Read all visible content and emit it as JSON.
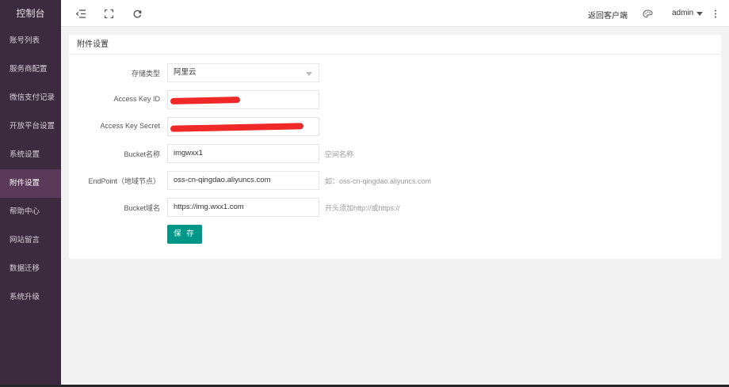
{
  "sidebar": {
    "brand": "控制台",
    "items": [
      {
        "label": "账号列表"
      },
      {
        "label": "服务商配置"
      },
      {
        "label": "微信支付记录"
      },
      {
        "label": "开放平台设置"
      },
      {
        "label": "系统设置"
      },
      {
        "label": "附件设置",
        "active": true
      },
      {
        "label": "帮助中心"
      },
      {
        "label": "网站留言"
      },
      {
        "label": "数据迁移"
      },
      {
        "label": "系统升级"
      }
    ]
  },
  "topbar": {
    "back_label": "返回客户端",
    "user_label": "admin"
  },
  "panel": {
    "title": "附件设置",
    "fields": {
      "storage": {
        "label": "存储类型",
        "value": "阿里云"
      },
      "access_key_id": {
        "label": "Access Key ID",
        "value": ""
      },
      "access_key_secret": {
        "label": "Access Key Secret",
        "value": ""
      },
      "bucket": {
        "label": "Bucket名称",
        "value": "imgwxx1",
        "hint": "空间名称"
      },
      "endpoint": {
        "label": "EndPoint（地域节点）",
        "value": "oss-cn-qingdao.aliyuncs.com",
        "hint": "如：oss-cn-qingdao.aliyuncs.com"
      },
      "domain": {
        "label": "Bucket域名",
        "value": "https://img.wxx1.com",
        "hint": "开头须加http://或https://"
      }
    },
    "save_label": "保 存"
  },
  "colors": {
    "sidebar_bg": "#3c2a3e",
    "sidebar_active": "#5a3a58",
    "primary_button": "#009688",
    "redaction": "#ee1c1c"
  }
}
